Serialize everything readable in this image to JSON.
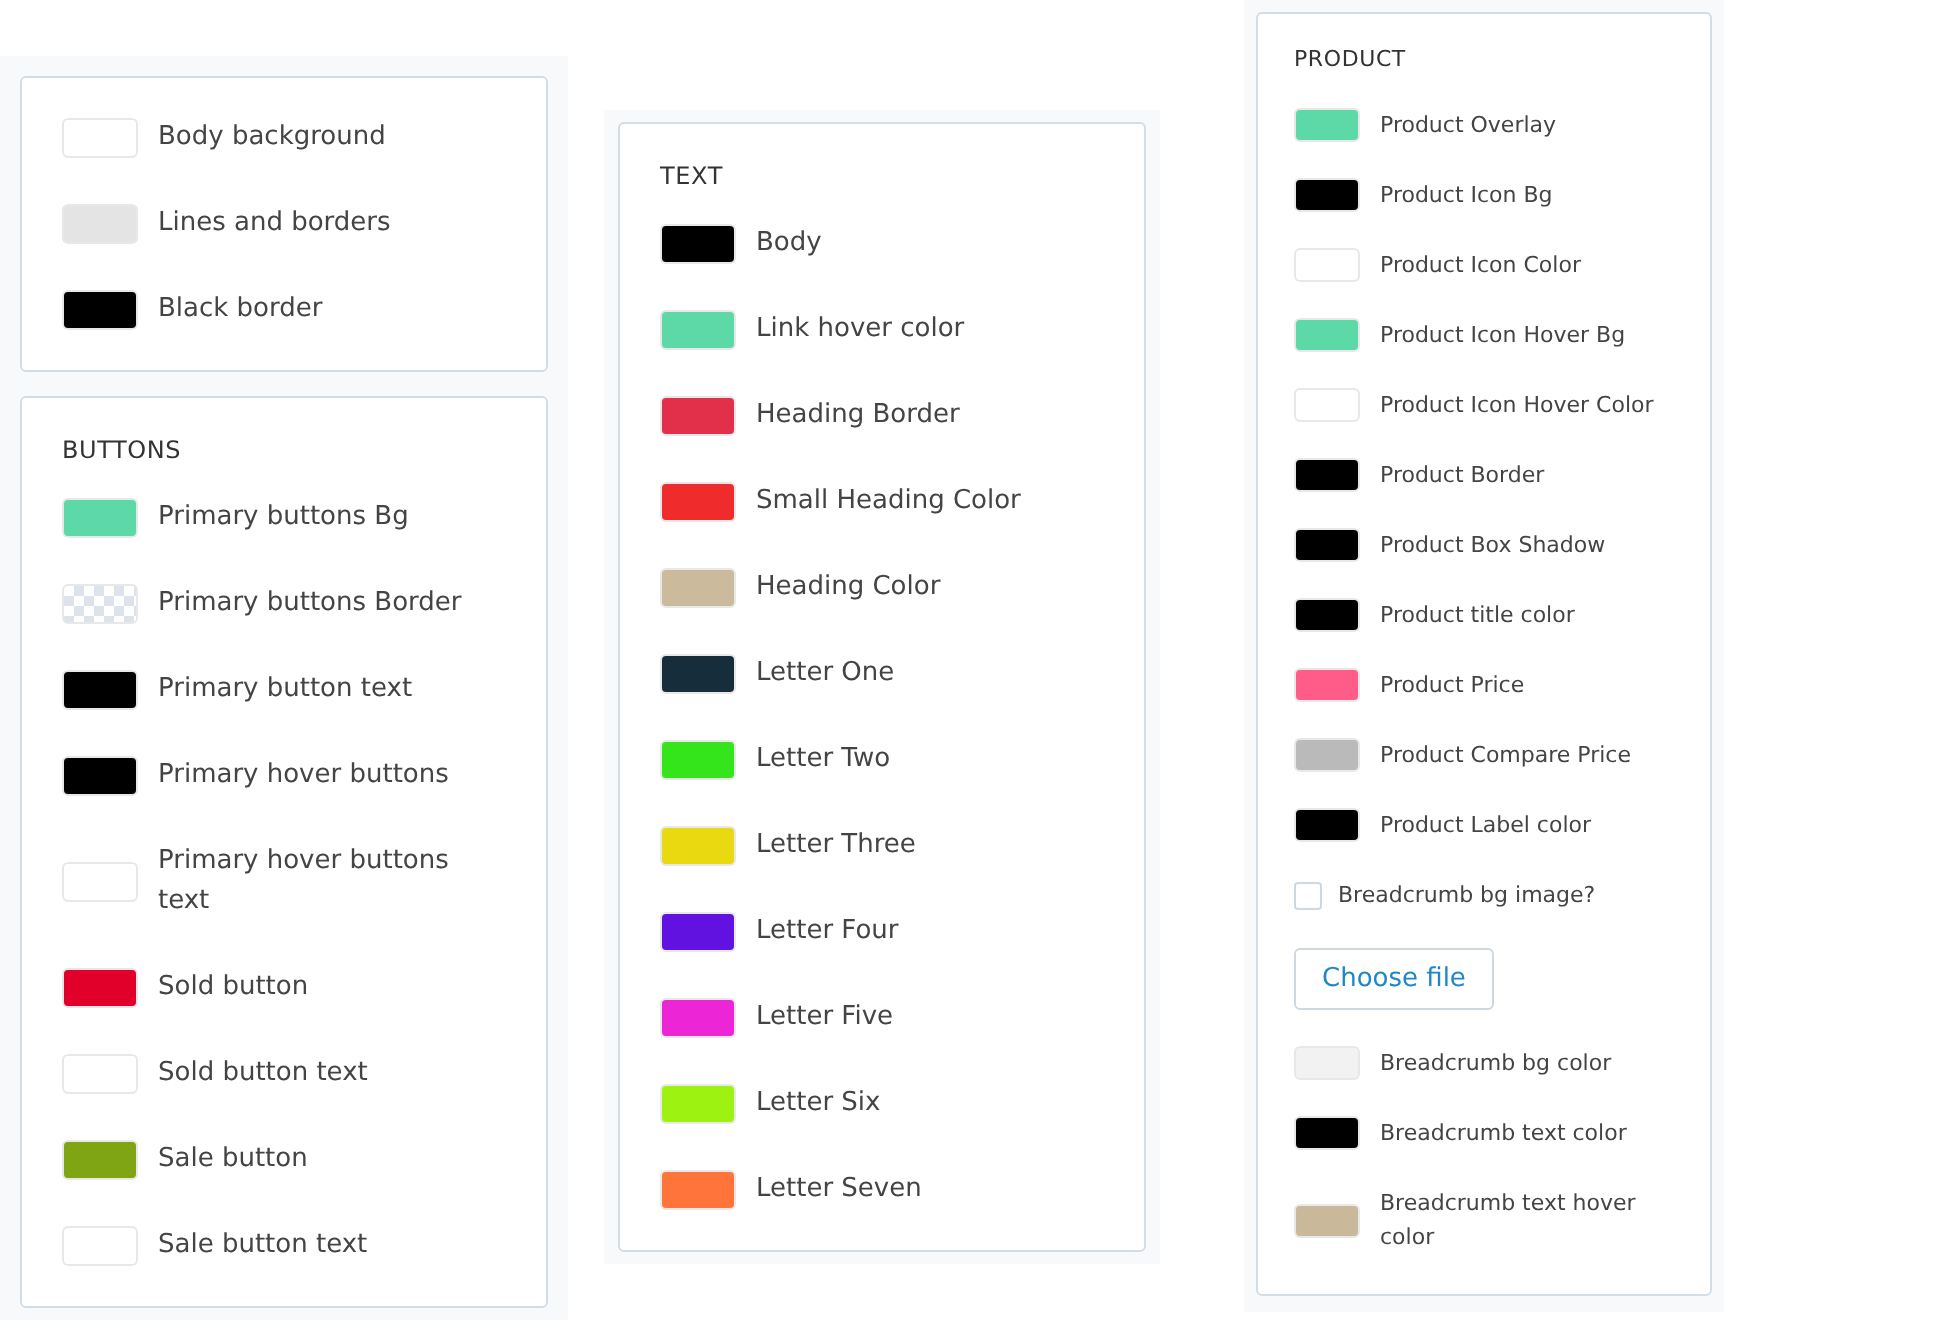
{
  "columns": [
    {
      "sections": [
        {
          "items": [
            {
              "kind": "swatch",
              "label": "Body background",
              "color": "#ffffff"
            },
            {
              "kind": "swatch",
              "label": "Lines and borders",
              "color": "#e4e4e4"
            },
            {
              "kind": "swatch",
              "label": "Black border",
              "color": "#000000"
            }
          ]
        },
        {
          "heading": "BUTTONS",
          "items": [
            {
              "kind": "swatch",
              "label": "Primary buttons Bg",
              "color": "#5dd9a8"
            },
            {
              "kind": "transparent",
              "label": "Primary buttons Border"
            },
            {
              "kind": "swatch",
              "label": "Primary button text",
              "color": "#000000"
            },
            {
              "kind": "swatch",
              "label": "Primary hover buttons",
              "color": "#000000"
            },
            {
              "kind": "swatch",
              "label": "Primary hover buttons text",
              "color": "#ffffff"
            },
            {
              "kind": "swatch",
              "label": "Sold button",
              "color": "#e0002a"
            },
            {
              "kind": "swatch",
              "label": "Sold button text",
              "color": "#ffffff"
            },
            {
              "kind": "swatch",
              "label": "Sale button",
              "color": "#7fa512"
            },
            {
              "kind": "swatch",
              "label": "Sale button text",
              "color": "#ffffff"
            }
          ]
        }
      ]
    },
    {
      "sections": [
        {
          "heading": "TEXT",
          "items": [
            {
              "kind": "swatch",
              "label": "Body",
              "color": "#000000"
            },
            {
              "kind": "swatch",
              "label": "Link hover color",
              "color": "#5dd9a8"
            },
            {
              "kind": "swatch",
              "label": "Heading Border",
              "color": "#e3304a"
            },
            {
              "kind": "swatch",
              "label": "Small Heading Color",
              "color": "#f02b2b"
            },
            {
              "kind": "swatch",
              "label": "Heading Color",
              "color": "#cbba9b"
            },
            {
              "kind": "swatch",
              "label": "Letter One",
              "color": "#162d3b"
            },
            {
              "kind": "swatch",
              "label": "Letter Two",
              "color": "#35e51c"
            },
            {
              "kind": "swatch",
              "label": "Letter Three",
              "color": "#e8d911"
            },
            {
              "kind": "swatch",
              "label": "Letter Four",
              "color": "#6212e0"
            },
            {
              "kind": "swatch",
              "label": "Letter Five",
              "color": "#ec25d6"
            },
            {
              "kind": "swatch",
              "label": "Letter Six",
              "color": "#9ef212"
            },
            {
              "kind": "swatch",
              "label": "Letter Seven",
              "color": "#ff7438"
            }
          ]
        }
      ]
    },
    {
      "sections": [
        {
          "heading": "PRODUCT",
          "items": [
            {
              "kind": "swatch",
              "label": "Product Overlay",
              "color": "#5dd9a8"
            },
            {
              "kind": "swatch",
              "label": "Product Icon Bg",
              "color": "#000000"
            },
            {
              "kind": "swatch",
              "label": "Product Icon Color",
              "color": "#ffffff"
            },
            {
              "kind": "swatch",
              "label": "Product Icon Hover Bg",
              "color": "#5dd9a8"
            },
            {
              "kind": "swatch",
              "label": "Product Icon Hover Color",
              "color": "#ffffff"
            },
            {
              "kind": "swatch",
              "label": "Product Border",
              "color": "#000000"
            },
            {
              "kind": "swatch",
              "label": "Product Box Shadow",
              "color": "#000000"
            },
            {
              "kind": "swatch",
              "label": "Product title color",
              "color": "#000000"
            },
            {
              "kind": "swatch",
              "label": "Product Price",
              "color": "#ff5c8a"
            },
            {
              "kind": "swatch",
              "label": "Product Compare Price",
              "color": "#bababa"
            },
            {
              "kind": "swatch",
              "label": "Product Label color",
              "color": "#000000"
            },
            {
              "kind": "checkbox",
              "label": "Breadcrumb bg image?",
              "checked": false
            },
            {
              "kind": "file",
              "label": "Choose file"
            },
            {
              "kind": "swatch",
              "label": "Breadcrumb bg color",
              "color": "#f2f2f2"
            },
            {
              "kind": "swatch",
              "label": "Breadcrumb text color",
              "color": "#000000"
            },
            {
              "kind": "swatch",
              "label": "Breadcrumb text hover color",
              "color": "#c9b99a"
            }
          ]
        }
      ]
    }
  ]
}
